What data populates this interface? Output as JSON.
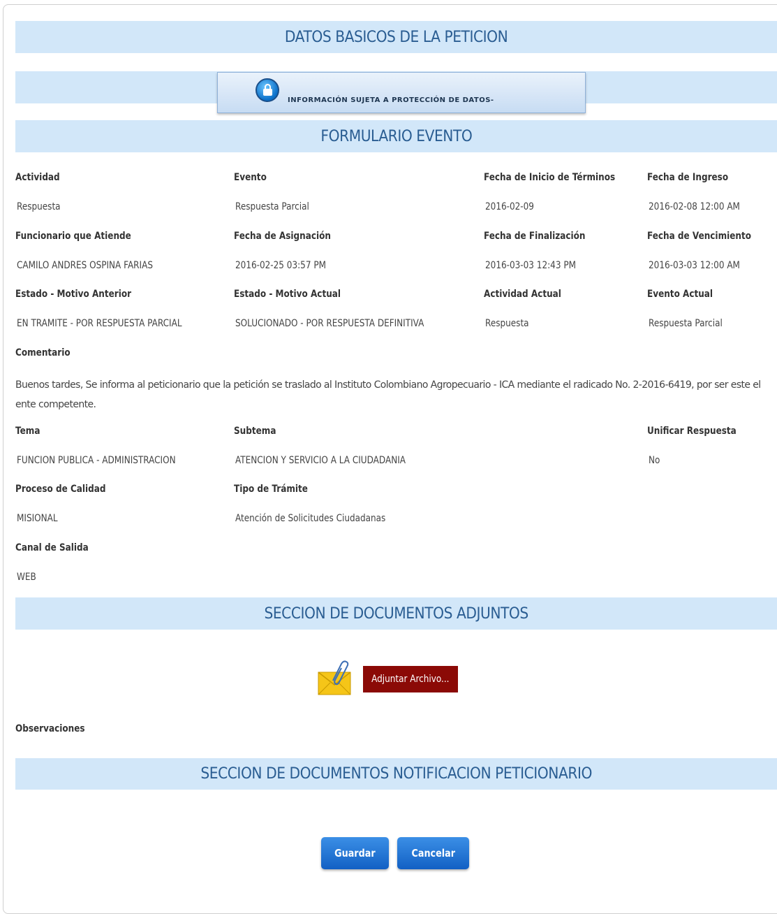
{
  "sections": {
    "datos_basicos": "DATOS BASICOS DE LA PETICION",
    "proteccion": "INFORMACIÓN SUJETA A PROTECCIÓN DE DATOS-",
    "formulario_evento": "FORMULARIO EVENTO",
    "documentos_adjuntos": "SECCION DE DOCUMENTOS ADJUNTOS",
    "documentos_notificacion": "SECCION DE DOCUMENTOS NOTIFICACION PETICIONARIO"
  },
  "fields": {
    "actividad": {
      "label": "Actividad",
      "value": "Respuesta"
    },
    "evento": {
      "label": "Evento",
      "value": "Respuesta Parcial"
    },
    "fecha_inicio_terminos": {
      "label": "Fecha de Inicio de Términos",
      "value": "2016-02-09"
    },
    "fecha_ingreso": {
      "label": "Fecha de Ingreso",
      "value": "2016-02-08 12:00 AM"
    },
    "funcionario": {
      "label": "Funcionario que Atiende",
      "value": "CAMILO ANDRES  OSPINA FARIAS"
    },
    "fecha_asignacion": {
      "label": "Fecha de Asignación",
      "value": "2016-02-25 03:57 PM"
    },
    "fecha_finalizacion": {
      "label": "Fecha de Finalización",
      "value": "2016-03-03 12:43 PM"
    },
    "fecha_vencimiento": {
      "label": "Fecha de Vencimiento",
      "value": "2016-03-03 12:00 AM"
    },
    "estado_anterior": {
      "label": "Estado - Motivo Anterior",
      "value": "EN TRAMITE - POR RESPUESTA PARCIAL"
    },
    "estado_actual": {
      "label": "Estado - Motivo Actual",
      "value": "SOLUCIONADO - POR RESPUESTA DEFINITIVA"
    },
    "actividad_actual": {
      "label": "Actividad Actual",
      "value": "Respuesta"
    },
    "evento_actual": {
      "label": "Evento Actual",
      "value": "Respuesta Parcial"
    },
    "comentario": {
      "label": "Comentario",
      "value": "Buenos tardes, Se informa al peticionario que la petición se traslado al Instituto Colombiano Agropecuario - ICA mediante el radicado No. 2-2016-6419, por ser este el ente competente."
    },
    "tema": {
      "label": "Tema",
      "value": "FUNCION PUBLICA - ADMINISTRACION"
    },
    "subtema": {
      "label": "Subtema",
      "value": "ATENCION Y SERVICIO A LA CIUDADANIA"
    },
    "unificar": {
      "label": "Unificar Respuesta",
      "value": "No"
    },
    "proceso_calidad": {
      "label": "Proceso de Calidad",
      "value": "MISIONAL"
    },
    "tipo_tramite": {
      "label": "Tipo de Trámite",
      "value": "Atención de Solicitudes Ciudadanas"
    },
    "canal_salida": {
      "label": "Canal de Salida",
      "value": "WEB"
    }
  },
  "attachments": {
    "button_label": "Adjuntar Archivo...",
    "icon": "envelope-paperclip-icon",
    "observaciones_label": "Observaciones"
  },
  "actions": {
    "save": "Guardar",
    "cancel": "Cancelar"
  },
  "colors": {
    "band_bg": "#d2e7f9",
    "band_text": "#2a5d92",
    "attach_button": "#8b0a06",
    "primary_button": "#1f72d6"
  }
}
